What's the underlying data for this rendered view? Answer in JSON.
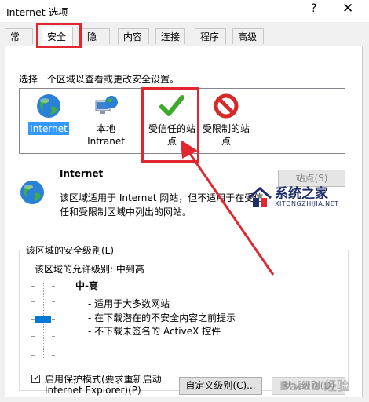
{
  "window": {
    "title": "Internet 选项",
    "help": "?",
    "close": "✕"
  },
  "tabs": [
    "常规",
    "安全",
    "隐私",
    "内容",
    "连接",
    "程序",
    "高级"
  ],
  "security": {
    "prompt": "选择一个区域以查看或更改安全设置。",
    "zones": [
      {
        "label": "Internet",
        "icon": "globe-icon"
      },
      {
        "label": "本地\nIntranet",
        "icon": "intranet-icon"
      },
      {
        "label": "受信任的站\n点",
        "icon": "check-icon"
      },
      {
        "label": "受限制的站\n点",
        "icon": "restricted-icon"
      }
    ],
    "zone_name": "Internet",
    "zone_desc": "该区域适用于 Internet 网站，但不适用于在受信任和受限制区域中列出的网站。",
    "sites_button": "站点(S)",
    "level_group_title": "该区域的安全级别(L)",
    "allowed_levels": "该区域的允许级别: 中到高",
    "level_name": "中-高",
    "level_bullets": [
      "- 适用于大多数网站",
      "- 在下载潜在的不安全内容之前提示",
      "- 不下载未签名的 ActiveX 控件"
    ],
    "protected_mode_line1": "启用保护模式(要求重新启动",
    "protected_mode_line2": "Internet Explorer)(P)",
    "protected_mode_checked": true,
    "custom_level_button": "自定义级别(C)...",
    "default_level_button": "默认级别(D)"
  },
  "watermarks": {
    "site": "系统之家",
    "url": "XITONGZHIJIA.NET",
    "baidu": "Baidu 经验"
  },
  "colors": {
    "selection": "#3399ff",
    "annotation": "#e0262e",
    "accent": "#0078d7"
  }
}
